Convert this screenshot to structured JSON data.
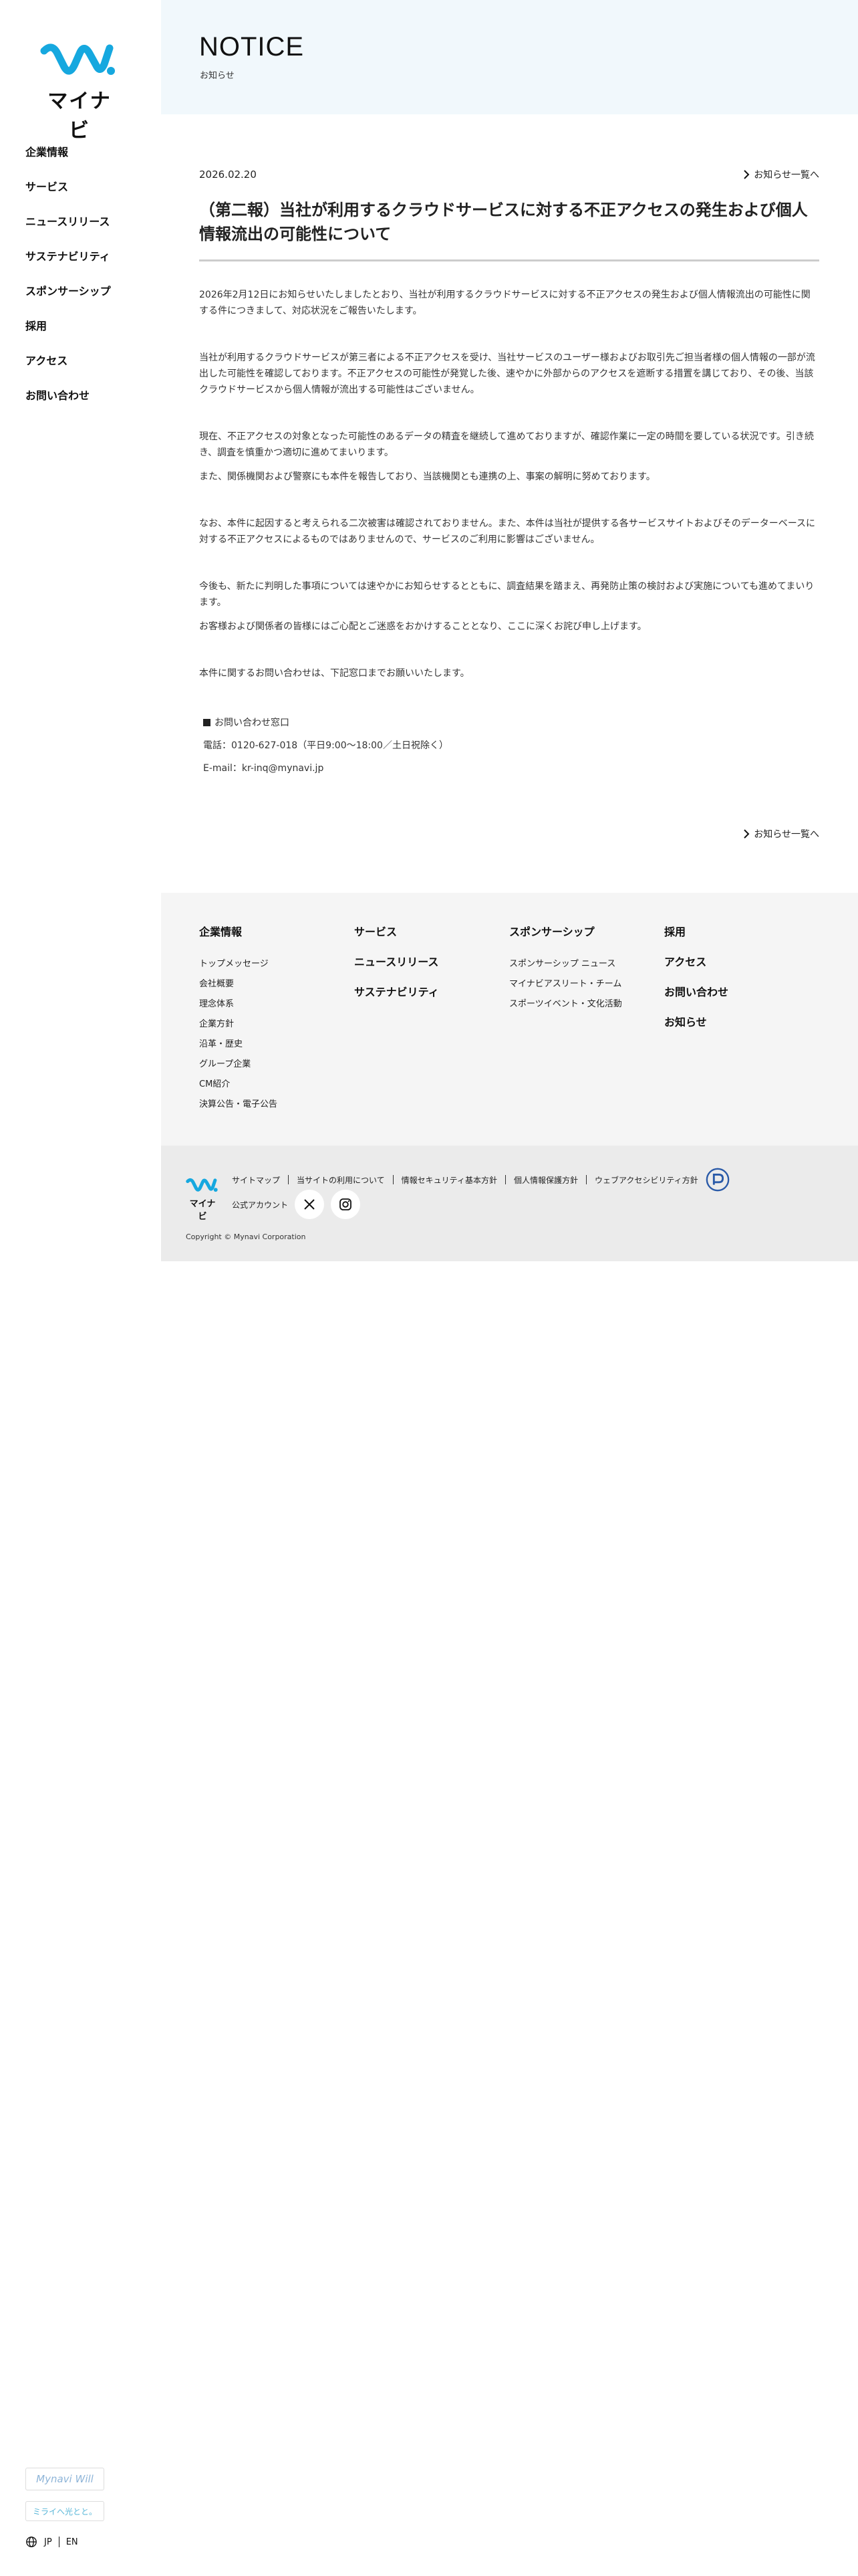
{
  "brand": {
    "logo_text": "マイナビ",
    "accent": "#16a8df"
  },
  "sidebar": {
    "nav": [
      "企業情報",
      "サービス",
      "ニュースリリース",
      "サステナビリティ",
      "スポンサーシップ",
      "採用",
      "アクセス",
      "お問い合わせ"
    ],
    "banners": {
      "will_a": "Mynavi",
      "will_b": "Will",
      "mitai": "ミライへ光とと。"
    },
    "lang": {
      "jp": "JP",
      "en": "EN"
    }
  },
  "hero": {
    "title": "NOTICE",
    "subtitle": "お知らせ"
  },
  "article": {
    "date": "2026.02.20",
    "back_label": "お知らせ一覧へ",
    "title": "（第二報）当社が利用するクラウドサービスに対する不正アクセスの発生および個人情報流出の可能性について",
    "paragraphs": [
      "2026年2月12日にお知らせいたしましたとおり、当社が利用するクラウドサービスに対する不正アクセスの発生および個人情報流出の可能性に関する件につきまして、対応状況をご報告いたします。",
      "当社が利用するクラウドサービスが第三者による不正アクセスを受け、当社サービスのユーザー様およびお取引先ご担当者様の個人情報の一部が流出した可能性を確認しております。不正アクセスの可能性が発覚した後、速やかに外部からのアクセスを遮断する措置を講じており、その後、当該クラウドサービスから個人情報が流出する可能性はございません。",
      "現在、不正アクセスの対象となった可能性のあるデータの精査を継続して進めておりますが、確認作業に一定の時間を要している状況です。引き続き、調査を慎重かつ適切に進めてまいります。",
      "また、関係機関および警察にも本件を報告しており、当該機関とも連携の上、事案の解明に努めております。",
      "なお、本件に起因すると考えられる二次被害は確認されておりません。また、本件は当社が提供する各サービスサイトおよびそのデーターベースに対する不正アクセスによるものではありませんので、サービスのご利用に影響はございません。",
      "今後も、新たに判明した事項については速やかにお知らせするとともに、調査結果を踏まえ、再発防止策の検討および実施についても進めてまいります。",
      "お客様および関係者の皆様にはご心配とご迷惑をおかけすることとなり、ここに深くお詫び申し上げます。",
      "本件に関するお問い合わせは、下記窓口までお願いいたします。"
    ],
    "contact": {
      "heading": "お問い合わせ窓口",
      "phone": "電話：0120-627-018（平日9:00～18:00／土日祝除く）",
      "email": "E-mail：kr-inq@mynavi.jp"
    }
  },
  "footer": {
    "col1": {
      "heading": "企業情報",
      "items": [
        "トップメッセージ",
        "会社概要",
        "理念体系",
        "企業方針",
        "沿革・歴史",
        "グループ企業",
        "CM紹介",
        "決算公告・電子公告"
      ]
    },
    "col2": {
      "items": [
        "サービス",
        "ニュースリリース",
        "サステナビリティ"
      ]
    },
    "col3": {
      "heading": "スポンサーシップ",
      "items": [
        "スポンサーシップ ニュース",
        "マイナビアスリート・チーム",
        "スポーツイベント・文化活動"
      ]
    },
    "col4": {
      "items": [
        "採用",
        "アクセス",
        "お問い合わせ",
        "お知らせ"
      ]
    }
  },
  "subfooter": {
    "links": [
      "サイトマップ",
      "当サイトの利用について",
      "情報セキュリティ基本方針",
      "個人情報保護方針",
      "ウェブアクセシビリティ方針"
    ],
    "official": "公式アカウント",
    "copyright": "Copyright © Mynavi Corporation"
  }
}
